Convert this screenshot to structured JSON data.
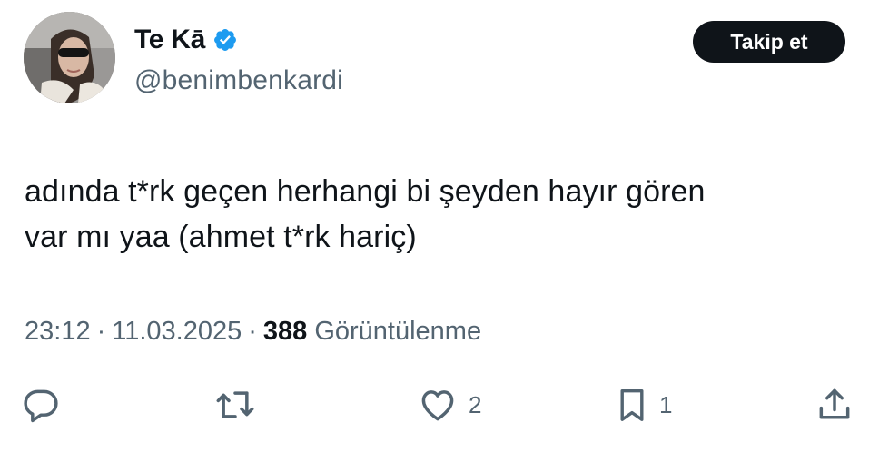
{
  "user": {
    "display_name": "Te Kā",
    "handle": "@benimbenkardi",
    "verified_icon": "verified-badge-icon",
    "avatar_icon": "profile-photo"
  },
  "follow_button": {
    "label": "Takip et"
  },
  "tweet": {
    "text_line1": "adında t*rk geçen herhangi bi şeyden hayır gören",
    "text_line2": "var mı yaa (ahmet t*rk hariç)"
  },
  "meta": {
    "time": "23:12",
    "separator1": "·",
    "date": "11.03.2025",
    "separator2": "·",
    "views_count": "388",
    "views_label": "Görüntülenme"
  },
  "actions": {
    "reply": {
      "icon": "reply-icon",
      "count": ""
    },
    "retweet": {
      "icon": "retweet-icon",
      "count": ""
    },
    "like": {
      "icon": "heart-icon",
      "count": "2"
    },
    "bookmark": {
      "icon": "bookmark-icon",
      "count": "1"
    },
    "share": {
      "icon": "share-icon",
      "count": ""
    }
  },
  "colors": {
    "text_primary": "#0f1419",
    "text_secondary": "#536471",
    "verified_blue": "#1d9bf0",
    "button_bg": "#0f1419",
    "button_text": "#ffffff"
  }
}
